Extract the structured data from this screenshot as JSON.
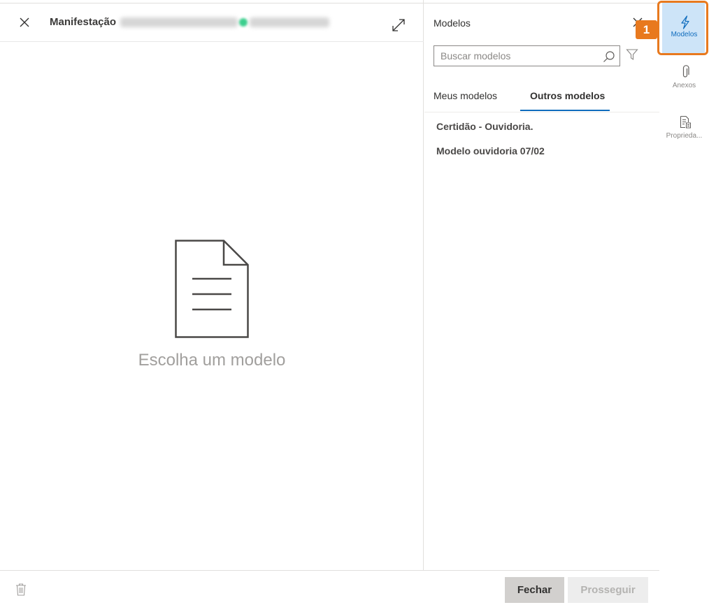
{
  "header": {
    "title": "Manifestação"
  },
  "empty_state": {
    "text": "Escolha um modelo"
  },
  "footer": {
    "close_label": "Fechar",
    "proceed_label": "Prosseguir"
  },
  "models_panel": {
    "title": "Modelos",
    "search_placeholder": "Buscar modelos",
    "tabs": [
      {
        "label": "Meus modelos",
        "active": false
      },
      {
        "label": "Outros modelos",
        "active": true
      }
    ],
    "items": [
      {
        "label": "Certidão - Ouvidoria."
      },
      {
        "label": "Modelo ouvidoria 07/02"
      }
    ]
  },
  "rail": {
    "items": [
      {
        "label": "Modelos",
        "icon": "lightning-icon",
        "active": true
      },
      {
        "label": "Anexos",
        "icon": "paperclip-icon",
        "active": false
      },
      {
        "label": "Proprieda...",
        "icon": "properties-icon",
        "active": false
      }
    ]
  },
  "annotation": {
    "callout_number": "1"
  },
  "colors": {
    "accent": "#0f6cbd",
    "active_rail_bg": "#cde4f8",
    "highlight": "#e8791e",
    "status_dot": "#3ccf8e"
  }
}
